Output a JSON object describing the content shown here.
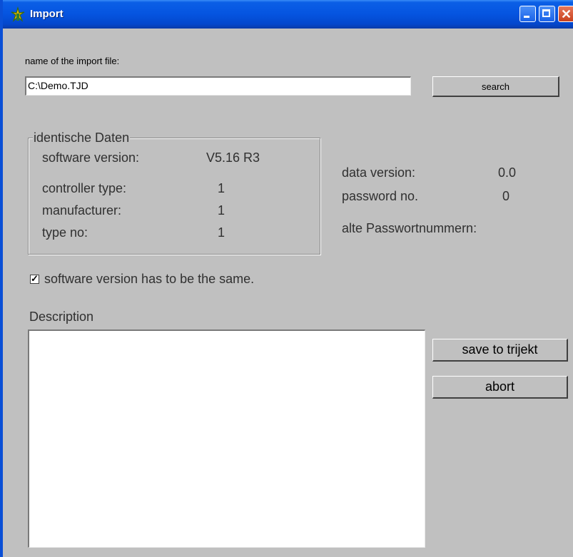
{
  "window": {
    "title": "Import",
    "titlebar_color": "#0554e0"
  },
  "file": {
    "label": "name of the import file:",
    "value": "C:\\Demo.TJD",
    "search_label": "search"
  },
  "identical": {
    "title": "identische Daten",
    "software_version_label": "software version:",
    "software_version_value": "V5.16 R3",
    "controller_type_label": "controller type:",
    "controller_type_value": "1",
    "manufacturer_label": "manufacturer:",
    "manufacturer_value": "1",
    "type_no_label": "type no:",
    "type_no_value": "1"
  },
  "info": {
    "data_version_label": "data version:",
    "data_version_value": "0.0",
    "password_label": "password no.",
    "password_value": "0",
    "old_passwords_label": "alte Passwortnummern:"
  },
  "options": {
    "same_version_label": "software version has to be the same.",
    "same_version_checked": true
  },
  "description": {
    "label": "Description",
    "value": ""
  },
  "actions": {
    "save_label": "save to trijekt",
    "abort_label": "abort"
  }
}
